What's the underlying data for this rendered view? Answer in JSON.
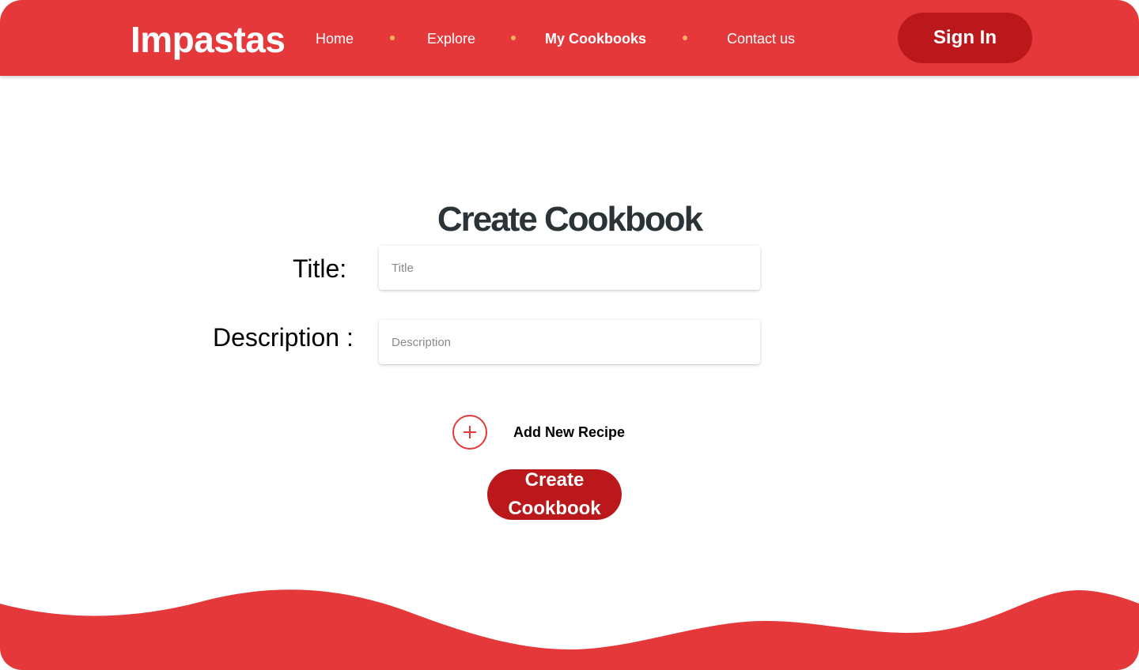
{
  "header": {
    "logo": "Impastas",
    "nav": [
      {
        "label": "Home",
        "active": false
      },
      {
        "label": "Explore",
        "active": false
      },
      {
        "label": "My Cookbooks",
        "active": true
      },
      {
        "label": "Contact us",
        "active": false
      }
    ],
    "sign_in_label": "Sign In"
  },
  "main": {
    "title": "Create Cookbook",
    "title_field": {
      "label": "Title:",
      "placeholder": "Title",
      "value": ""
    },
    "description_field": {
      "label": "Description :",
      "placeholder": "Description",
      "value": ""
    },
    "add_recipe_label": "Add New Recipe",
    "add_recipe_icon": "plus-circle-icon",
    "create_button_label": "Create Cookbook"
  },
  "colors": {
    "primary_red": "#e5383b",
    "dark_red": "#ba181b",
    "nav_dot": "#f6b35f",
    "title_text": "#2b3336"
  }
}
